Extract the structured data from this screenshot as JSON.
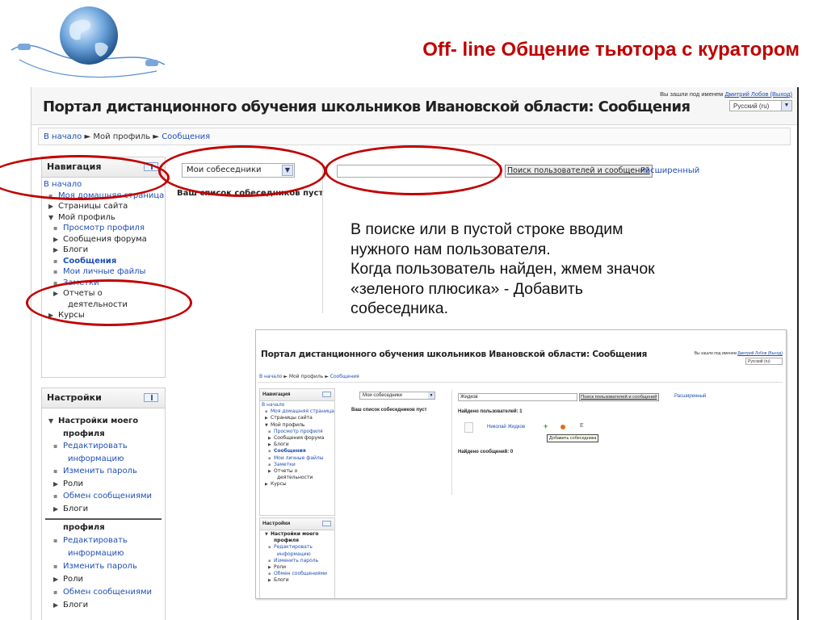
{
  "slide": {
    "title": "Off- line Общение тьютора с куратором",
    "instructions": [
      "В поиске или в пустой строке вводим",
      "нужного нам пользователя.",
      "Когда пользователь найден, жмем значок",
      "«зеленого плюсика» - Добавить",
      "собеседника."
    ]
  },
  "portal": {
    "title": "Портал дистанционного обучения школьников Ивановской области: Сообщения",
    "login_prefix": "Вы зашли под именем",
    "login_user": "Дмитрий Лобов (Выход)",
    "language": "Русский (ru)",
    "breadcrumb": {
      "home": "В начало",
      "profile": "Мой профиль",
      "current": "Сообщения",
      "sep": "►"
    }
  },
  "navigation": {
    "title": "Навигация",
    "items": [
      {
        "label": "В начало",
        "type": "link",
        "indent": 0,
        "marker": ""
      },
      {
        "label": "Моя домашняя страница",
        "type": "link",
        "indent": 1,
        "marker": "bullet"
      },
      {
        "label": "Страницы сайта",
        "type": "text",
        "indent": 1,
        "marker": "tri-right"
      },
      {
        "label": "Мой профиль",
        "type": "text",
        "indent": 1,
        "marker": "tri-down"
      },
      {
        "label": "Просмотр профиля",
        "type": "link",
        "indent": 2,
        "marker": "bullet"
      },
      {
        "label": "Сообщения форума",
        "type": "text",
        "indent": 2,
        "marker": "tri-right"
      },
      {
        "label": "Блоги",
        "type": "text",
        "indent": 2,
        "marker": "tri-right"
      },
      {
        "label": "Сообщения",
        "type": "bold-link",
        "indent": 2,
        "marker": "bullet"
      },
      {
        "label": "Мои личные файлы",
        "type": "link",
        "indent": 2,
        "marker": "bullet"
      },
      {
        "label": "Заметки",
        "type": "link",
        "indent": 2,
        "marker": "bullet"
      },
      {
        "label": "Отчеты о",
        "type": "text",
        "indent": 2,
        "marker": "tri-right"
      },
      {
        "label": "деятельности",
        "type": "text",
        "indent": 3,
        "marker": ""
      },
      {
        "label": "Курсы",
        "type": "text",
        "indent": 1,
        "marker": "tri-right"
      }
    ]
  },
  "settings": {
    "title": "Настройки",
    "items": [
      {
        "label": "Настройки моего",
        "type": "bold",
        "indent": 1,
        "marker": "tri-down"
      },
      {
        "label": "профиля",
        "type": "bold",
        "indent": 2,
        "marker": ""
      },
      {
        "label": "Редактировать",
        "type": "link",
        "indent": 2,
        "marker": "bullet"
      },
      {
        "label": "информацию",
        "type": "link",
        "indent": 3,
        "marker": ""
      },
      {
        "label": "Изменить пароль",
        "type": "link",
        "indent": 2,
        "marker": "bullet"
      },
      {
        "label": "Роли",
        "type": "text",
        "indent": 2,
        "marker": "tri-right"
      },
      {
        "label": "Обмен сообщениями",
        "type": "link",
        "indent": 2,
        "marker": "bullet"
      },
      {
        "label": "Блоги",
        "type": "text",
        "indent": 2,
        "marker": "tri-right"
      }
    ],
    "overflow_items": [
      {
        "label": "профиля",
        "type": "bold",
        "indent": 2,
        "marker": ""
      },
      {
        "label": "Редактировать",
        "type": "link",
        "indent": 2,
        "marker": "bullet"
      },
      {
        "label": "информацию",
        "type": "link",
        "indent": 3,
        "marker": ""
      },
      {
        "label": "Изменить пароль",
        "type": "link",
        "indent": 2,
        "marker": "bullet"
      },
      {
        "label": "Роли",
        "type": "text",
        "indent": 2,
        "marker": "tri-right"
      },
      {
        "label": "Обмен сообщениями",
        "type": "link",
        "indent": 2,
        "marker": "bullet"
      },
      {
        "label": "Блоги",
        "type": "text",
        "indent": 2,
        "marker": "tri-right"
      }
    ]
  },
  "messages": {
    "contacts_select": "Мои собеседники",
    "contacts_empty": "Ваш список собеседников пуст",
    "search_value": "",
    "search_button": "Поиск пользователей и сообщений",
    "advanced_link": "Расширенный"
  },
  "inner": {
    "search_value": "Жидков",
    "found_users": "Найдено пользователей: 1",
    "user_name": "Николай Жидков",
    "plus_icon": "+",
    "history_icon": "E",
    "tooltip": "Добавить собеседника",
    "found_messages": "Найдено сообщений: 0"
  },
  "colors": {
    "accent": "#c00000",
    "link": "#1f4fb5",
    "plus": "#2e9e2e"
  },
  "icons": {
    "globe": "globe-network-icon",
    "dock": "dock-block-icon",
    "add": "plus-icon",
    "block": "block-contact-icon",
    "history": "history-icon"
  }
}
